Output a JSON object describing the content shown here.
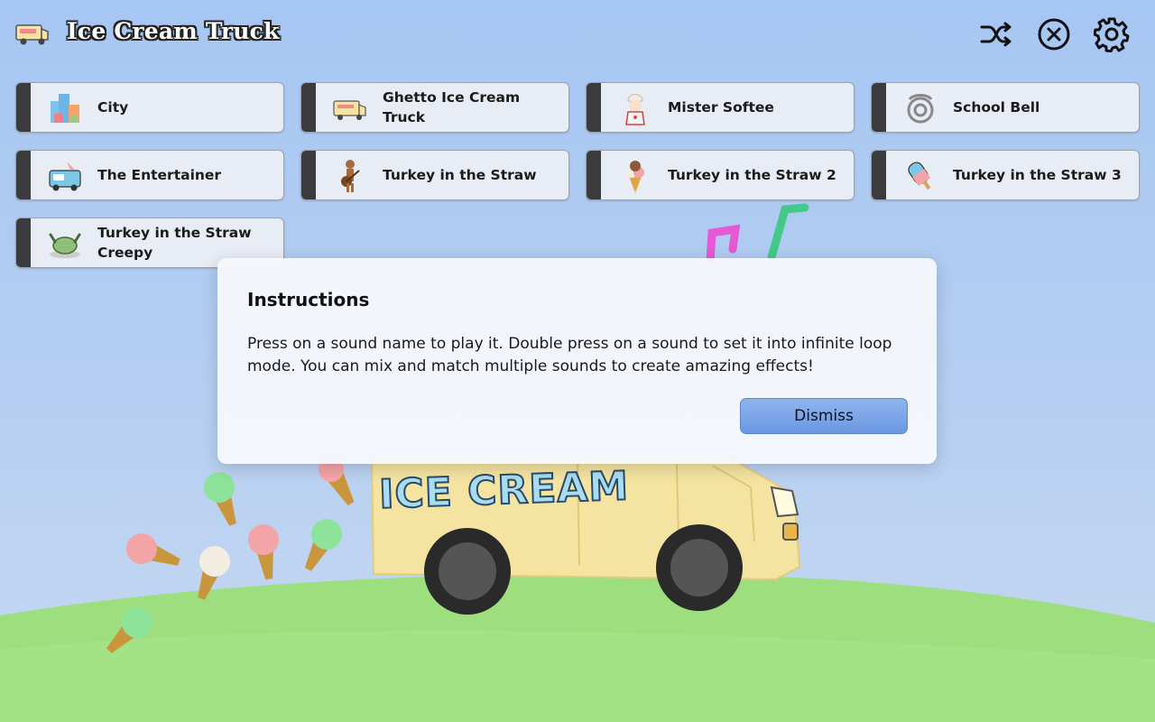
{
  "app": {
    "title": "Ice Cream Truck"
  },
  "header": {
    "buttons": [
      {
        "name": "shuffle-icon"
      },
      {
        "name": "stop-all-icon"
      },
      {
        "name": "gear-icon"
      }
    ]
  },
  "sounds": [
    {
      "label": "City",
      "icon": "city-icon"
    },
    {
      "label": "Ghetto Ice Cream Truck",
      "icon": "truck-icon"
    },
    {
      "label": "Mister Softee",
      "icon": "mister-softee-icon"
    },
    {
      "label": "School Bell",
      "icon": "bell-icon"
    },
    {
      "label": "The Entertainer",
      "icon": "food-truck-icon"
    },
    {
      "label": "Turkey in the Straw",
      "icon": "guitarist-icon"
    },
    {
      "label": "Turkey in the Straw 2",
      "icon": "ice-cream-cone-icon"
    },
    {
      "label": "Turkey in the Straw 3",
      "icon": "popsicle-icon"
    },
    {
      "label": "Turkey in the Straw Creepy",
      "icon": "roast-turkey-icon"
    }
  ],
  "dialog": {
    "title": "Instructions",
    "body": "Press on a sound name to play it. Double press on a sound to set it into infinite loop mode. You can mix and match multiple sounds to create amazing effects!",
    "dismiss_label": "Dismiss"
  },
  "scene": {
    "truck_sign": "ICE CREAM"
  },
  "colors": {
    "sky": "#a6c6f3",
    "grass": "#9be07a",
    "truck": "#f6e7a6",
    "tile": "#e8edf5",
    "strip": "#3b3b3d",
    "button": "#7aa6ea"
  }
}
